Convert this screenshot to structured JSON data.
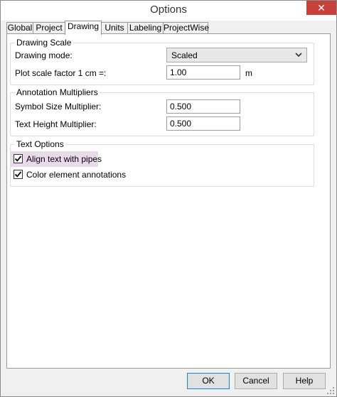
{
  "window": {
    "title": "Options",
    "close_glyph": "✕"
  },
  "tabs": [
    {
      "label": "Global"
    },
    {
      "label": "Project"
    },
    {
      "label": "Drawing",
      "active": true
    },
    {
      "label": "Units"
    },
    {
      "label": "Labeling"
    },
    {
      "label": "ProjectWise"
    }
  ],
  "drawing_scale": {
    "title": "Drawing Scale",
    "mode_label": "Drawing mode:",
    "mode_value": "Scaled",
    "plot_label": "Plot scale factor  1 cm =:",
    "plot_value": "1.00",
    "plot_unit": "m"
  },
  "annotation": {
    "title": "Annotation Multipliers",
    "symbol_label": "Symbol Size Multiplier:",
    "symbol_value": "0.500",
    "text_label": "Text Height Multiplier:",
    "text_value": "0.500"
  },
  "text_options": {
    "title": "Text Options",
    "align_label": "Align text with pipes",
    "align_checked": true,
    "color_label": "Color element annotations",
    "color_checked": true
  },
  "buttons": {
    "ok": "OK",
    "cancel": "Cancel",
    "help": "Help"
  },
  "colors": {
    "close": "#c7403a",
    "highlight": "#e9dcea",
    "default_button_border": "#3c7fb1"
  },
  "icons": {
    "close": "close-icon",
    "dropdown": "chevron-down-icon",
    "check": "check-icon",
    "grip": "resize-grip-icon"
  }
}
